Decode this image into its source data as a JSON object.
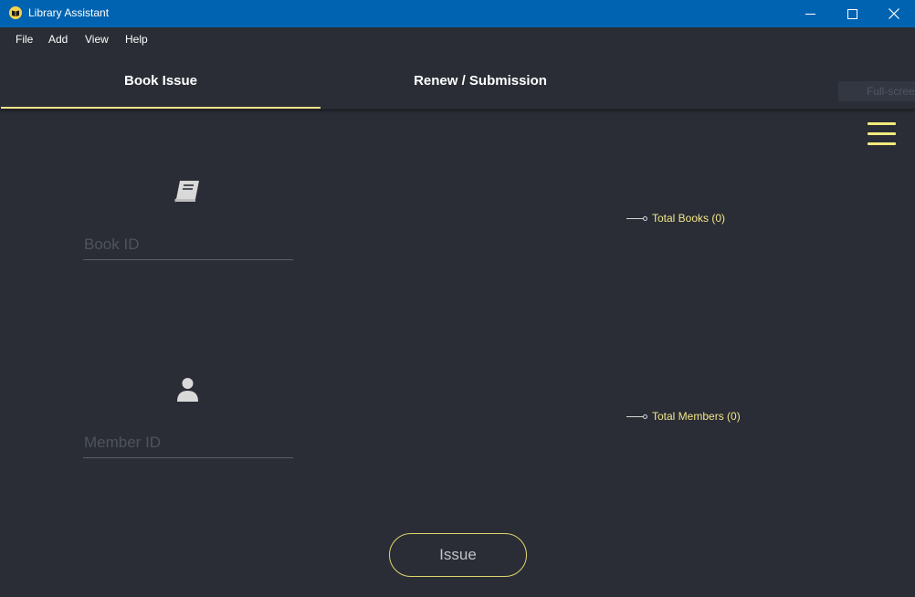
{
  "window": {
    "title": "Library Assistant",
    "controls": [
      "minimize-icon",
      "maximize-icon",
      "close-icon"
    ]
  },
  "menu": {
    "items": [
      {
        "label": "File"
      },
      {
        "label": "Add"
      },
      {
        "label": "View"
      },
      {
        "label": "Help"
      }
    ]
  },
  "tabs": [
    {
      "label": "Book Issue",
      "selected": true
    },
    {
      "label": "Renew / Submission",
      "selected": false
    }
  ],
  "toolbar": {
    "fullscreen_hint": "Full-screen",
    "menu_icon": "hamburger-icon"
  },
  "issue_form": {
    "book_icon": "book-icon",
    "book_id_placeholder": "Book ID",
    "book_id_value": "",
    "member_icon": "user-icon",
    "member_id_placeholder": "Member ID",
    "member_id_value": "",
    "issue_label": "Issue"
  },
  "stats": {
    "total_books_label": "Total Books (0)",
    "total_members_label": "Total Members (0)"
  },
  "colors": {
    "titlebar": "#0063b1",
    "background": "#2a2d35",
    "accent": "#f2ea7d"
  }
}
